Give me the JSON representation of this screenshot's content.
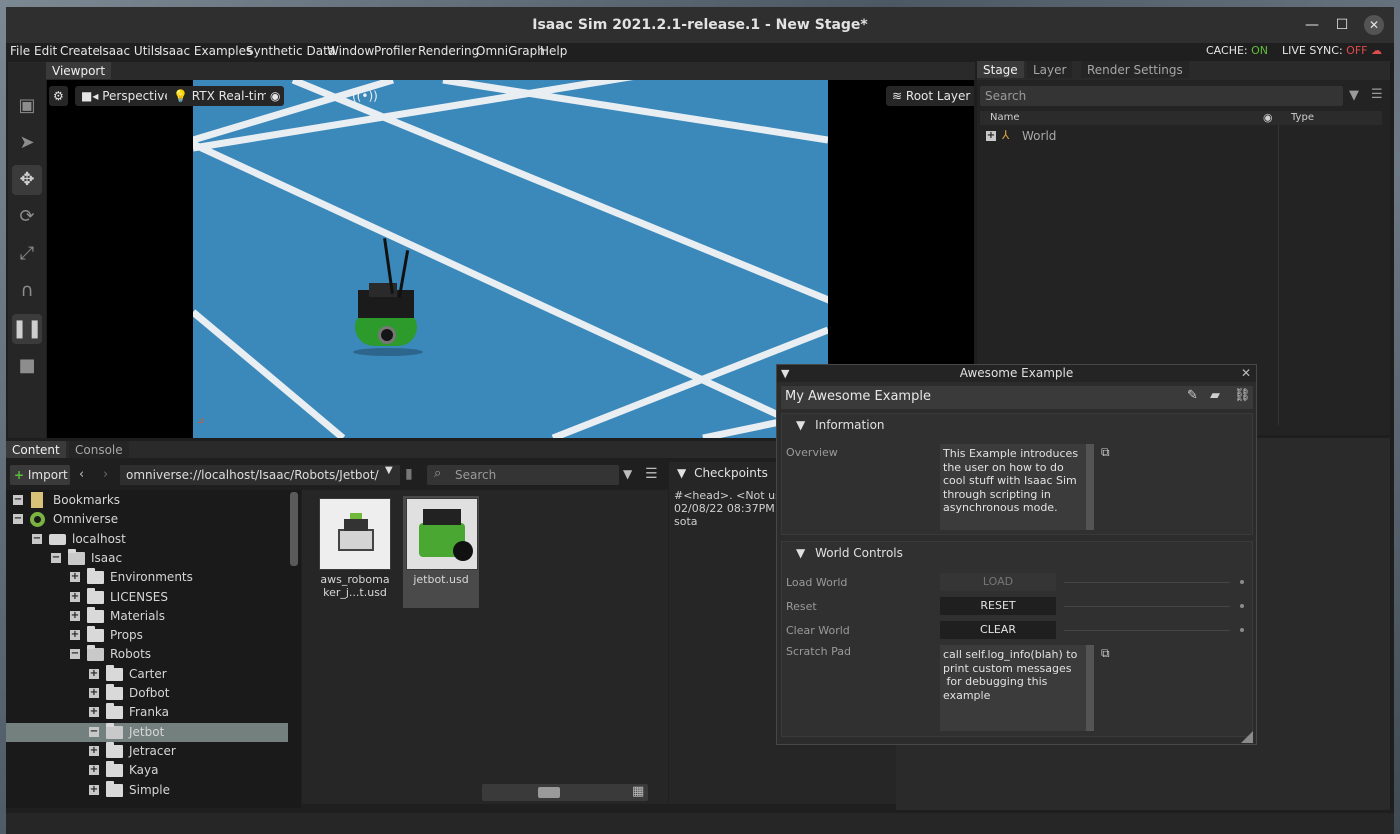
{
  "window": {
    "title": "Isaac Sim 2021.2.1-release.1 - New Stage*",
    "minimize": "—",
    "maximize": "☐",
    "close": "✕"
  },
  "menu": {
    "items": [
      "File",
      "Edit",
      "Create",
      "Isaac Utils",
      "Isaac Examples",
      "Synthetic Data",
      "Window",
      "Profiler",
      "Rendering",
      "OmniGraph",
      "Help"
    ],
    "cache_label": "CACHE:",
    "cache_value": "ON",
    "live_sync_label": "LIVE SYNC:",
    "live_sync_value": "OFF"
  },
  "viewport": {
    "tab": "Viewport",
    "camera": "Perspective",
    "renderer": "RTX Real-time",
    "layer": "Root Layer"
  },
  "stage": {
    "tabs": [
      "Stage",
      "Layer",
      "Render Settings"
    ],
    "search_placeholder": "Search",
    "col_name": "Name",
    "col_type": "Type",
    "root_item": "World"
  },
  "content": {
    "tabs": [
      "Content",
      "Console"
    ],
    "import_label": "Import",
    "path": "omniverse://localhost/Isaac/Robots/Jetbot/",
    "search_placeholder": "Search",
    "tree": [
      {
        "label": "Bookmarks",
        "depth": 0,
        "icon": "bookmark-icon",
        "expander": "−"
      },
      {
        "label": "Omniverse",
        "depth": 0,
        "icon": "omniverse-icon",
        "expander": "−"
      },
      {
        "label": "localhost",
        "depth": 1,
        "icon": "server-icon",
        "expander": "−"
      },
      {
        "label": "Isaac",
        "depth": 2,
        "icon": "folder-open-icon",
        "expander": "−"
      },
      {
        "label": "Environments",
        "depth": 3,
        "icon": "folder-icon",
        "expander": "+"
      },
      {
        "label": "LICENSES",
        "depth": 3,
        "icon": "folder-icon",
        "expander": "+"
      },
      {
        "label": "Materials",
        "depth": 3,
        "icon": "folder-icon",
        "expander": "+"
      },
      {
        "label": "Props",
        "depth": 3,
        "icon": "folder-icon",
        "expander": "+"
      },
      {
        "label": "Robots",
        "depth": 3,
        "icon": "folder-open-icon",
        "expander": "−"
      },
      {
        "label": "Carter",
        "depth": 4,
        "icon": "folder-icon",
        "expander": "+"
      },
      {
        "label": "Dofbot",
        "depth": 4,
        "icon": "folder-icon",
        "expander": "+"
      },
      {
        "label": "Franka",
        "depth": 4,
        "icon": "folder-icon",
        "expander": "+"
      },
      {
        "label": "Jetbot",
        "depth": 4,
        "icon": "folder-open-icon",
        "expander": "−",
        "selected": true
      },
      {
        "label": "Jetracer",
        "depth": 4,
        "icon": "folder-icon",
        "expander": "+"
      },
      {
        "label": "Kaya",
        "depth": 4,
        "icon": "folder-icon",
        "expander": "+"
      },
      {
        "label": "Simple",
        "depth": 4,
        "icon": "folder-icon",
        "expander": "+"
      }
    ],
    "files": [
      {
        "label_line1": "aws_roboma",
        "label_line2": "ker_j...t.usd"
      },
      {
        "label_line1": "jetbot.usd",
        "label_line2": ""
      }
    ]
  },
  "checkpoints": {
    "title": "Checkpoints",
    "line1": "#<head>.   <Not usin",
    "line2": "02/08/22 08:37PM",
    "line3": "sota"
  },
  "example": {
    "window_title": "Awesome Example",
    "header": "My Awesome Example",
    "information_title": "Information",
    "overview_label": "Overview",
    "overview_text": "This Example introduces the user on how to do cool stuff with Isaac Sim through scripting in asynchronous mode.",
    "world_controls_title": "World Controls",
    "load_world_label": "Load World",
    "load_button": "LOAD",
    "reset_label": "Reset",
    "reset_button": "RESET",
    "clear_world_label": "Clear World",
    "clear_button": "CLEAR",
    "scratch_label": "Scratch Pad",
    "scratch_text": "call self.log_info(blah) to print custom messages\n for debugging this example"
  }
}
